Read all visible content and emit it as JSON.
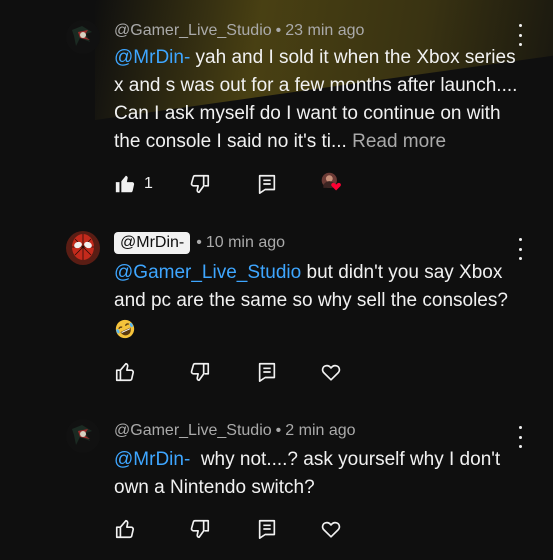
{
  "comments": [
    {
      "author": "@Gamer_Live_Studio",
      "time": "23 min ago",
      "mention": "@MrDin-",
      "text": " yah and I sold it when the Xbox series x and s was out for a few months after launch.... Can I ask myself do I want to continue on with the console I said no it's ti...",
      "read_more": "Read more",
      "like_count": "1",
      "highlighted": true
    },
    {
      "author": "@MrDin-",
      "time": "10 min ago",
      "mention": "@Gamer_Live_Studio",
      "text": " but didn't you say Xbox and pc are the same so why sell the consoles?",
      "emoji": "rolling-on-floor-laughing",
      "like_count": ""
    },
    {
      "author": "@Gamer_Live_Studio",
      "time": "2 min ago",
      "mention": "@MrDin-",
      "text": "  why not....? ask yourself why I don't own a Nintendo switch?",
      "like_count": ""
    }
  ],
  "separator": "•",
  "icons": {
    "like": "thumbs-up-icon",
    "dislike": "thumbs-down-icon",
    "reply": "reply-icon",
    "heart": "heart-icon",
    "menu": "more-vertical-icon"
  },
  "colors": {
    "background": "#0f0f0f",
    "text": "#f1f1f1",
    "secondary": "#aaaaaa",
    "mention": "#3ea6ff",
    "heart": "#ff0033"
  }
}
